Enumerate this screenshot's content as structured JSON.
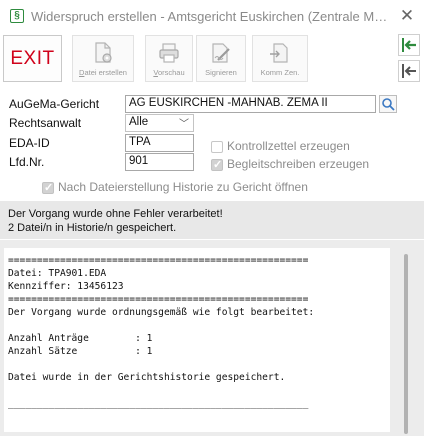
{
  "window": {
    "title": "Widerspruch erstellen - Amtsgericht Euskirchen (Zentrale Mahnab...",
    "app_icon": "§"
  },
  "toolbar": {
    "exit_label": "EXIT",
    "buttons": [
      {
        "label_underline": "D",
        "label_rest": "atei erstellen",
        "icon": "document-gear-icon"
      },
      {
        "label_underline": "V",
        "label_rest": "orschau",
        "icon": "printer-preview-icon"
      },
      {
        "label_underline": "",
        "label_rest": "Signieren",
        "icon": "signature-pen-icon"
      },
      {
        "label_underline": "",
        "label_rest": "Komm Zen.",
        "icon": "document-transfer-icon"
      }
    ]
  },
  "form": {
    "augema_label": "AuGeMa-Gericht",
    "augema_value": "AG EUSKIRCHEN -MAHNAB. ZEMA II",
    "rechtsanwalt_label": "Rechtsanwalt",
    "rechtsanwalt_value": "Alle",
    "eda_label": "EDA-ID",
    "eda_value": "TPA",
    "lfdnr_label": "Lfd.Nr.",
    "lfdnr_value": "901",
    "kontrollzettel_label": "Kontrollzettel erzeugen",
    "kontrollzettel_checked": false,
    "begleitschreiben_label": "Begleitschreiben erzeugen",
    "begleitschreiben_checked": true,
    "historie_label": "Nach Dateierstellung Historie zu Gericht öffnen",
    "historie_checked": true
  },
  "message": {
    "line1": "Der Vorgang wurde ohne Fehler verarbeitet!",
    "line2": "2 Datei/n in Historie/n gespeichert."
  },
  "log": {
    "text": "====================================================\nDatei: TPA901.EDA\nKennziffer: 13456123\n====================================================\nDer Vorgang wurde ordnungsgemäß wie folgt bearbeitet:\n\nAnzahl Anträge        : 1\nAnzahl Sätze          : 1\n\nDatei wurde in der Gerichtshistorie gespeichert.\n\n____________________________________________________"
  }
}
